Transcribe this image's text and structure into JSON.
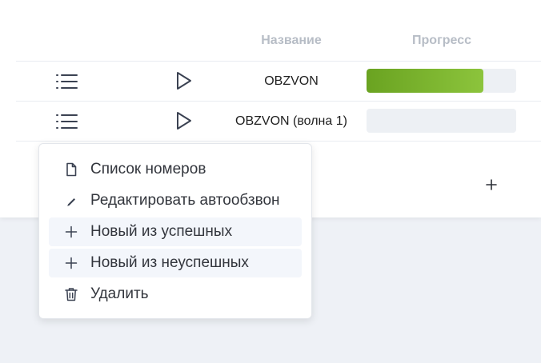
{
  "table": {
    "headers": {
      "name": "Название",
      "progress": "Прогресс"
    },
    "rows": [
      {
        "name": "OBZVON",
        "progress": 0.78
      },
      {
        "name": "OBZVON (волна 1)",
        "progress": 0
      }
    ]
  },
  "context_menu": {
    "items": [
      {
        "label": "Список номеров",
        "icon": "file-icon"
      },
      {
        "label": "Редактировать автообзвон",
        "icon": "pencil-icon"
      },
      {
        "label": "Новый из успешных",
        "icon": "plus-icon"
      },
      {
        "label": "Новый из неуспешных",
        "icon": "plus-icon"
      },
      {
        "label": "Удалить",
        "icon": "trash-icon"
      }
    ]
  },
  "colors": {
    "progress_start": "#6aa321",
    "progress_end": "#8cc43c",
    "header_text": "#b7bdc6",
    "icon_stroke": "#3b4252"
  }
}
